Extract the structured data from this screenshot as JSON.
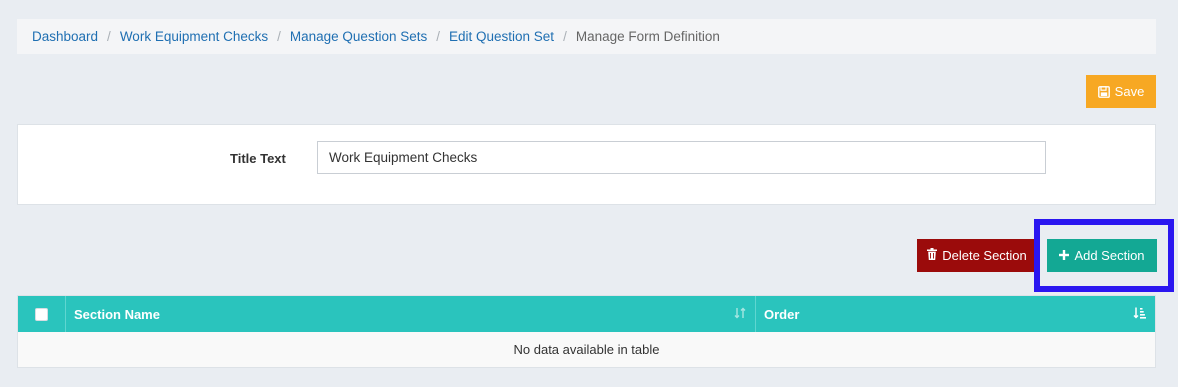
{
  "breadcrumb": {
    "items": [
      "Dashboard",
      "Work Equipment Checks",
      "Manage Question Sets",
      "Edit Question Set"
    ],
    "current": "Manage Form Definition",
    "separator": "/"
  },
  "toolbar": {
    "save_label": "Save",
    "save_color": "#f7a823"
  },
  "form": {
    "title_label": "Title Text",
    "title_value": "Work Equipment Checks"
  },
  "actions": {
    "delete_label": "Delete Section",
    "delete_color": "#9b0b0b",
    "add_label": "Add Section",
    "add_color": "#13a894"
  },
  "table": {
    "header_color": "#2ac4bd",
    "columns": [
      "Section Name",
      "Order"
    ],
    "empty_message": "No data available in table"
  },
  "icons": {
    "save": "floppy-disk-icon",
    "delete": "trash-icon",
    "add": "plus-icon",
    "sort_name": "sort-both-icon",
    "sort_order": "sort-amount-asc-icon"
  }
}
